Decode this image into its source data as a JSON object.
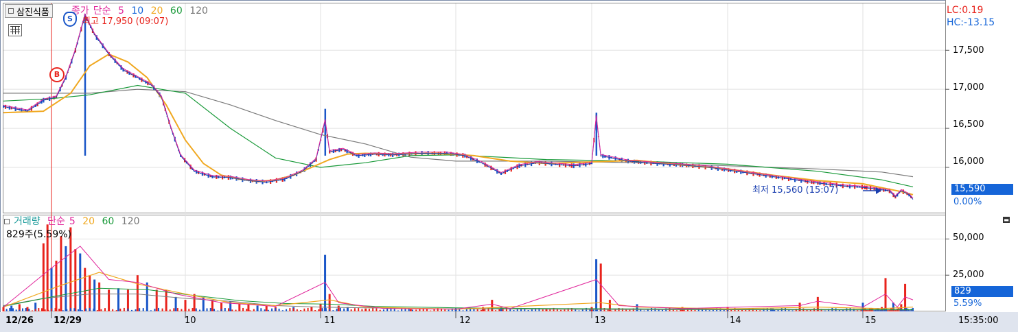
{
  "stock": {
    "name": "삼진식품"
  },
  "price_legend": {
    "close_label": "종가",
    "ma_label": "단순",
    "periods": [
      "5",
      "10",
      "20",
      "60",
      "120"
    ],
    "colors": [
      "#e0249a",
      "#1565d8",
      "#f0a820",
      "#1a9a3a",
      "#777777"
    ]
  },
  "annotations": {
    "high_label": "최고 17,950 (09:07)",
    "low_label": "최저 15,560 (15:07)",
    "buy_marker": "B",
    "sell_marker": "S"
  },
  "right_info": {
    "lc": "LC:0.19",
    "hc": "HC:-13.15"
  },
  "price_axis": {
    "ticks": [
      "17,500",
      "17,000",
      "16,500",
      "16,000"
    ]
  },
  "current_price": {
    "value": "15,590",
    "change": "0.00%"
  },
  "volume_legend": {
    "label": "거래량",
    "ma_label": "단순",
    "periods": [
      "5",
      "20",
      "60",
      "120"
    ]
  },
  "volume_info": {
    "text": "829주(5.59%)"
  },
  "volume_axis": {
    "ticks": [
      "50,000",
      "25,000"
    ]
  },
  "current_volume": {
    "value": "829",
    "pct": "5.59%"
  },
  "x_axis": {
    "labels": [
      "12/26",
      "12/29",
      "10",
      "11",
      "12",
      "13",
      "14",
      "15"
    ],
    "time": "15:35:00"
  },
  "colors": {
    "up": "#e8231c",
    "down": "#1a56c8",
    "tag": "#1565d8",
    "highlight": "#e8231c"
  },
  "chart_data": {
    "type": "line",
    "price": {
      "x_unit": "trading sessions (12/26 .. 15)",
      "close": [
        [
          0,
          16780
        ],
        [
          0.3,
          16720
        ],
        [
          0.5,
          16860
        ],
        [
          0.65,
          16900
        ],
        [
          0.75,
          17150
        ],
        [
          0.85,
          17500
        ],
        [
          0.95,
          17950
        ],
        [
          1.05,
          17700
        ],
        [
          1.2,
          17450
        ],
        [
          1.35,
          17250
        ],
        [
          1.5,
          17150
        ],
        [
          1.65,
          17050
        ],
        [
          1.75,
          16900
        ],
        [
          1.85,
          16500
        ],
        [
          1.95,
          16150
        ],
        [
          2.1,
          15950
        ],
        [
          2.3,
          15880
        ],
        [
          2.5,
          15870
        ],
        [
          2.7,
          15830
        ],
        [
          2.9,
          15810
        ],
        [
          3.1,
          15850
        ],
        [
          3.3,
          15950
        ],
        [
          3.45,
          16100
        ],
        [
          3.55,
          16600
        ],
        [
          3.6,
          16200
        ],
        [
          3.75,
          16230
        ],
        [
          3.9,
          16150
        ],
        [
          4.1,
          16170
        ],
        [
          4.3,
          16160
        ],
        [
          4.6,
          16180
        ],
        [
          4.9,
          16180
        ],
        [
          5.1,
          16150
        ],
        [
          5.3,
          16050
        ],
        [
          5.5,
          15920
        ],
        [
          5.7,
          16020
        ],
        [
          5.9,
          16060
        ],
        [
          6.1,
          16040
        ],
        [
          6.3,
          16020
        ],
        [
          6.5,
          16050
        ],
        [
          6.55,
          16650
        ],
        [
          6.6,
          16150
        ],
        [
          6.9,
          16080
        ],
        [
          7.2,
          16050
        ],
        [
          7.5,
          16030
        ],
        [
          7.8,
          16000
        ],
        [
          8.1,
          15950
        ],
        [
          8.4,
          15900
        ],
        [
          8.7,
          15850
        ],
        [
          9.0,
          15800
        ],
        [
          9.3,
          15760
        ],
        [
          9.6,
          15740
        ],
        [
          9.9,
          15720
        ],
        [
          10.2,
          15700
        ],
        [
          10.35,
          15620
        ],
        [
          10.5,
          15700
        ],
        [
          10.7,
          15650
        ],
        [
          10.8,
          15590
        ]
      ],
      "ma20": [
        [
          0,
          16700
        ],
        [
          0.5,
          16720
        ],
        [
          0.8,
          16950
        ],
        [
          1.0,
          17300
        ],
        [
          1.2,
          17450
        ],
        [
          1.4,
          17350
        ],
        [
          1.6,
          17150
        ],
        [
          1.8,
          16800
        ],
        [
          2.0,
          16350
        ],
        [
          2.2,
          16050
        ],
        [
          2.4,
          15900
        ],
        [
          2.6,
          15850
        ],
        [
          2.8,
          15820
        ],
        [
          3.0,
          15840
        ],
        [
          3.2,
          15900
        ],
        [
          3.4,
          16000
        ],
        [
          3.6,
          16100
        ],
        [
          3.8,
          16170
        ],
        [
          4.0,
          16180
        ],
        [
          4.3,
          16170
        ],
        [
          4.8,
          16180
        ],
        [
          5.2,
          16150
        ],
        [
          5.6,
          16080
        ],
        [
          6.0,
          16050
        ],
        [
          6.5,
          16070
        ],
        [
          7.0,
          16090
        ],
        [
          7.5,
          16030
        ],
        [
          8.0,
          15980
        ],
        [
          8.5,
          15900
        ],
        [
          9.0,
          15830
        ],
        [
          9.5,
          15790
        ],
        [
          10.0,
          15740
        ],
        [
          10.5,
          15690
        ],
        [
          10.8,
          15650
        ]
      ],
      "ma60": [
        [
          0,
          16850
        ],
        [
          0.6,
          16880
        ],
        [
          1.0,
          16930
        ],
        [
          1.5,
          17050
        ],
        [
          2.0,
          16950
        ],
        [
          2.5,
          16500
        ],
        [
          3.0,
          16120
        ],
        [
          3.5,
          16000
        ],
        [
          4.0,
          16060
        ],
        [
          4.5,
          16150
        ],
        [
          5.0,
          16160
        ],
        [
          6.0,
          16100
        ],
        [
          7.0,
          16080
        ],
        [
          8.0,
          16040
        ],
        [
          9.0,
          15950
        ],
        [
          10.0,
          15840
        ],
        [
          10.8,
          15750
        ]
      ],
      "ma120": [
        [
          0,
          16950
        ],
        [
          1.0,
          16950
        ],
        [
          1.5,
          17000
        ],
        [
          2.0,
          16970
        ],
        [
          2.5,
          16800
        ],
        [
          3.0,
          16600
        ],
        [
          3.5,
          16420
        ],
        [
          4.0,
          16300
        ],
        [
          4.5,
          16130
        ],
        [
          5.0,
          16080
        ],
        [
          6.0,
          16080
        ],
        [
          7.0,
          16060
        ],
        [
          8.0,
          16020
        ],
        [
          9.0,
          15980
        ],
        [
          10.0,
          15940
        ],
        [
          10.8,
          15880
        ]
      ]
    },
    "volume": {
      "x_unit": "trading sessions",
      "bars": [
        [
          0,
          3000
        ],
        [
          0.1,
          4000
        ],
        [
          0.2,
          5000
        ],
        [
          0.3,
          3000
        ],
        [
          0.4,
          6000
        ],
        [
          0.5,
          47000
        ],
        [
          0.55,
          60000
        ],
        [
          0.6,
          30000
        ],
        [
          0.65,
          35000
        ],
        [
          0.7,
          52000
        ],
        [
          0.75,
          45000
        ],
        [
          0.8,
          58000
        ],
        [
          0.85,
          43000
        ],
        [
          0.9,
          40000
        ],
        [
          0.95,
          30000
        ],
        [
          1.0,
          25000
        ],
        [
          1.05,
          22000
        ],
        [
          1.1,
          20000
        ],
        [
          1.2,
          15000
        ],
        [
          1.3,
          16000
        ],
        [
          1.4,
          15000
        ],
        [
          1.5,
          25000
        ],
        [
          1.6,
          20000
        ],
        [
          1.7,
          15000
        ],
        [
          1.8,
          15000
        ],
        [
          1.9,
          10000
        ],
        [
          2.0,
          8000
        ],
        [
          2.1,
          12000
        ],
        [
          2.2,
          10000
        ],
        [
          2.3,
          8000
        ],
        [
          2.4,
          6000
        ],
        [
          2.5,
          7000
        ],
        [
          2.6,
          5000
        ],
        [
          2.7,
          5000
        ],
        [
          2.8,
          4000
        ],
        [
          2.9,
          4000
        ],
        [
          3.0,
          3000
        ],
        [
          3.2,
          3000
        ],
        [
          3.4,
          3000
        ],
        [
          3.5,
          5000
        ],
        [
          3.55,
          39000
        ],
        [
          3.6,
          12000
        ],
        [
          3.7,
          4000
        ],
        [
          3.8,
          3000
        ],
        [
          4.0,
          2000
        ],
        [
          4.5,
          1500
        ],
        [
          5.0,
          1500
        ],
        [
          5.3,
          3000
        ],
        [
          5.4,
          8000
        ],
        [
          5.5,
          3000
        ],
        [
          6.0,
          2000
        ],
        [
          6.5,
          3000
        ],
        [
          6.55,
          36000
        ],
        [
          6.6,
          33000
        ],
        [
          6.7,
          8000
        ],
        [
          7.0,
          5000
        ],
        [
          7.5,
          3000
        ],
        [
          8.0,
          3000
        ],
        [
          8.5,
          2000
        ],
        [
          8.8,
          6000
        ],
        [
          9.0,
          10000
        ],
        [
          9.5,
          6000
        ],
        [
          10.0,
          3000
        ],
        [
          10.1,
          23000
        ],
        [
          10.3,
          6000
        ],
        [
          10.5,
          5000
        ],
        [
          10.6,
          19000
        ]
      ],
      "ylim": [
        0,
        62000
      ]
    }
  }
}
